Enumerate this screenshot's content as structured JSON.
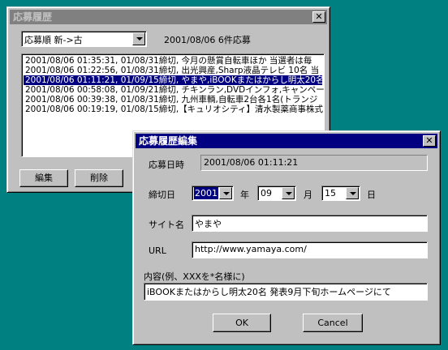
{
  "history_window": {
    "title": "応募履歴",
    "sort_select": "応募順  新->古",
    "summary": "2001/08/06  6件応募",
    "rows": [
      "2001/08/06 01:35:31, 01/08/31締切, 今月の懸賞自転車ほか  当選者は毎",
      "2001/08/06 01:22:56, 01/08/31締切, 出光興産,Sharp液晶テレビ 10名  当",
      "2001/08/06 01:11:21, 01/09/15締切, やまや,iBOOKまたはからし明太20名",
      "2001/08/06 00:58:08, 01/09/21締切, チキンラン,DVDインフォ,キャンペーン",
      "2001/08/06 00:39:38, 01/08/31締切, 九州車輌,自転車2台各1名(トランジ",
      "2001/08/06 00:19:19, 01/08/15締切,【キュリオシティ】清水製薬商事株式"
    ],
    "selected_index": 2,
    "edit_button": "編集",
    "delete_button": "削除"
  },
  "edit_dialog": {
    "title": "応募履歴編集",
    "applied_label": "応募日時",
    "applied_value": "2001/08/06  01:11:21",
    "deadline_label": "締切日",
    "year_value": "2001",
    "year_unit": "年",
    "month_value": "09",
    "month_unit": "月",
    "day_value": "15",
    "day_unit": "日",
    "site_label": "サイト名",
    "site_value": "やまや",
    "url_label": "URL",
    "url_value": "http://www.yamaya.com/",
    "content_label": "内容(例、XXXを*名様に)",
    "content_value": "iBOOKまたはからし明太20名  発表9月下旬ホームページにて",
    "ok_button": "OK",
    "cancel_button": "Cancel"
  }
}
